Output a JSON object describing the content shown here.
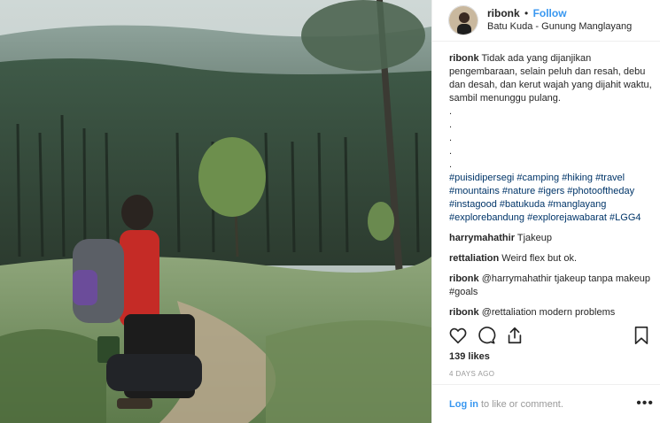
{
  "header": {
    "username": "ribonk",
    "separator": "•",
    "follow_label": "Follow",
    "location": "Batu Kuda - Gunung Manglayang"
  },
  "caption": {
    "username": "ribonk",
    "text": "Tidak ada yang dijanjikan pengembaraan, selain peluh dan resah, debu dan desah, dan kerut wajah yang dijahit waktu, sambil menunggu pulang.\n.\n.\n.\n.\n.",
    "hashtags": "#puisidipersegi #camping #hiking #travel #mountains #nature #igers #photooftheday #instagood #batukuda #manglayang #explorebandung #explorejawabarat #LGG4"
  },
  "comments": [
    {
      "username": "harrymahathir",
      "text": "Tjakeup"
    },
    {
      "username": "rettaliation",
      "text": "Weird flex but ok."
    },
    {
      "username": "ribonk",
      "text": "@harrymahathir tjakeup tanpa makeup #goals"
    },
    {
      "username": "ribonk",
      "text": "@rettaliation modern problems"
    }
  ],
  "actions": {
    "icons": [
      "heart-icon",
      "comment-icon",
      "share-icon",
      "bookmark-icon"
    ]
  },
  "likes": "139 likes",
  "timestamp": "4 DAYS AGO",
  "footer": {
    "login_label": "Log in",
    "placeholder": "to like or comment.",
    "more_label": "•••"
  },
  "colors": {
    "link_blue": "#3897f0",
    "hashtag": "#003569",
    "text": "#262626",
    "muted": "#999999"
  }
}
